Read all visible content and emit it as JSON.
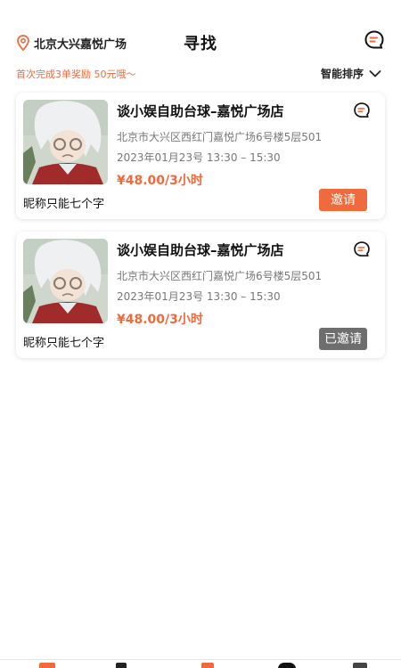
{
  "header": {
    "location": "北京大兴嘉悦广场",
    "title": "寻找"
  },
  "subbar": {
    "promo": "首次完成3单奖励 50元哦～",
    "sort_label": "智能排序"
  },
  "cards": [
    {
      "venue": "谈小娱自助台球–嘉悦广场店",
      "address": "北京市大兴区西红门嘉悦广场6号楼5层501",
      "time": "2023年01月23号 13:30 – 15:30",
      "price": "¥48.00/3小时",
      "nickname": "昵称只能七个字",
      "action": "邀请"
    },
    {
      "venue": "谈小娱自助台球–嘉悦广场店",
      "address": "北京市大兴区西红门嘉悦广场6号楼5层501",
      "time": "2023年01月23号 13:30 – 15:30",
      "price": "¥48.00/3小时",
      "nickname": "昵称只能七个字",
      "action": "已邀请"
    }
  ],
  "colors": {
    "accent": "#ef6a3c",
    "invited_gray": "#6e6e6e"
  },
  "icons": {
    "location": "location-pin-icon",
    "chat": "chat-bubble-icon",
    "sort": "chevron-down-icon"
  }
}
